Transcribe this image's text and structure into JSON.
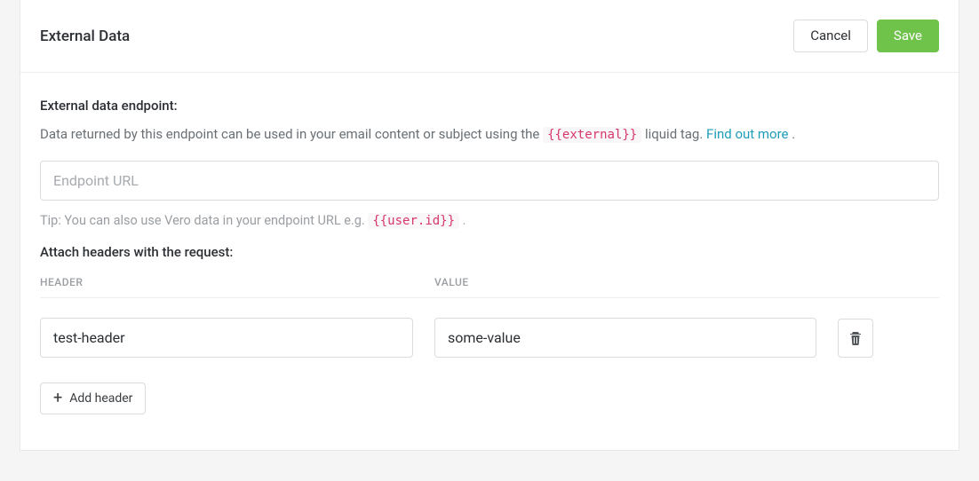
{
  "header": {
    "title": "External Data",
    "cancel_label": "Cancel",
    "save_label": "Save"
  },
  "endpoint": {
    "label": "External data endpoint:",
    "desc_pre": "Data returned by this endpoint can be used in your email content or subject using the ",
    "desc_code": "{{external}}",
    "desc_post": " liquid tag. ",
    "link_label": "Find out more",
    "desc_end": " .",
    "placeholder": "Endpoint URL",
    "value": "",
    "tip_pre": "Tip: You can also use Vero data in your endpoint URL e.g. ",
    "tip_code": "{{user.id}}",
    "tip_post": " ."
  },
  "headers_section": {
    "label": "Attach headers with the request:",
    "col_header": "HEADER",
    "col_value": "VALUE",
    "rows": [
      {
        "header": "test-header",
        "value": "some-value"
      }
    ],
    "add_label": "Add header"
  }
}
